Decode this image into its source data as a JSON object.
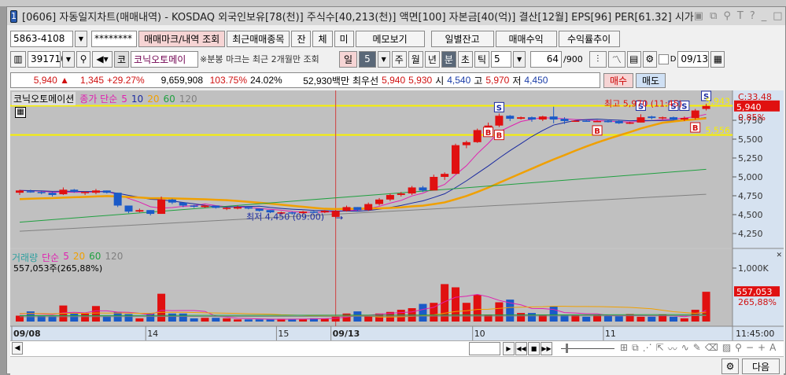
{
  "window": {
    "number": "1",
    "title": "[0606] 자동일지차트(매매내역) - KOSDAQ 외국인보유[78(천)] 주식수[40,213(천)] 액면[100] 자본금[40(억)] 결산[12월] EPS[96] PER[61.32] 시가"
  },
  "toolbar1": {
    "account": "5863-4108",
    "password": "********",
    "trade_mark_query": "매매마크/내역 조회",
    "recent_items": "최근매매종목",
    "jan": "잔",
    "che": "체",
    "mi": "미",
    "memo": "메모보기",
    "daily_balance": "일별잔고",
    "trade_profit": "매매수익",
    "return_trend": "수익률추이"
  },
  "toolbar2": {
    "code": "391710",
    "market": "코",
    "name": "코닉오토메이",
    "notice": "※분봉 마크는 최근 2개월만 조회",
    "day": "일",
    "day_n": "5",
    "week": "주",
    "month": "월",
    "year": "년",
    "minute": "분",
    "second": "초",
    "tick": "틱",
    "interval": "5",
    "count": "64",
    "count_max": "/900",
    "d_label": "D",
    "date": "09/13"
  },
  "quote": {
    "price": "5,940",
    "change": "1,345",
    "change_pct": "+29.27%",
    "volume": "9,659,908",
    "vol_ratio": "103.75%",
    "turnover": "24.02%",
    "amount": "52,930백만",
    "best_label": "최우선",
    "ask": "5,940",
    "bid": "5,930",
    "open_label": "시",
    "open": "4,540",
    "high_label": "고",
    "high": "5,970",
    "low_label": "저",
    "low": "4,450",
    "buy": "매수",
    "sell": "매도"
  },
  "price_pane": {
    "name": "코닉오토메이션",
    "ma_label": "종가 단순",
    "ma": [
      "5",
      "10",
      "20",
      "60",
      "120"
    ],
    "ma_colors": [
      "#e020b0",
      "#1a2aa0",
      "#f0a000",
      "#20a040",
      "#808080"
    ],
    "high_annot": "최고 5,970 (11:45)",
    "low_annot": "최저 4,450 (09:00)",
    "line_hi": "5,943",
    "line_lo": "5,556",
    "line_hi_val": 5943,
    "line_lo_val": 5556,
    "cur_label": "5,940",
    "c_label": "C:33.48",
    "pct_label": "0.85%",
    "axis": [
      "5,750",
      "5,500",
      "5,250",
      "5,000",
      "4,750",
      "4,500",
      "4,250"
    ]
  },
  "volume_pane": {
    "name": "거래량",
    "ma_label": "단순",
    "ma": [
      "5",
      "20",
      "60",
      "120"
    ],
    "current": "557,053주(265,88%)",
    "axis": "1,000K",
    "cur_vol": "557,053",
    "cur_pct": "265,88%"
  },
  "dates": [
    "09/08",
    "14",
    "15",
    "09/13",
    "10",
    "11"
  ],
  "time_label": "11:45:00",
  "bottom": {
    "next": "다음"
  },
  "chart_data": {
    "type": "candlestick",
    "ylim": [
      4150,
      6050
    ],
    "candles": [
      [
        4790,
        4830,
        4760,
        4820
      ],
      [
        4810,
        4830,
        4790,
        4800
      ],
      [
        4800,
        4810,
        4770,
        4790
      ],
      [
        4790,
        4800,
        4740,
        4760
      ],
      [
        4770,
        4860,
        4760,
        4830
      ],
      [
        4830,
        4840,
        4790,
        4800
      ],
      [
        4800,
        4810,
        4760,
        4800
      ],
      [
        4790,
        4840,
        4770,
        4820
      ],
      [
        4820,
        4820,
        4780,
        4790
      ],
      [
        4790,
        4790,
        4600,
        4620
      ],
      [
        4620,
        4620,
        4520,
        4540
      ],
      [
        4540,
        4580,
        4530,
        4560
      ],
      [
        4560,
        4560,
        4490,
        4510
      ],
      [
        4510,
        4740,
        4510,
        4700
      ],
      [
        4700,
        4710,
        4640,
        4660
      ],
      [
        4660,
        4660,
        4600,
        4620
      ],
      [
        4620,
        4630,
        4590,
        4610
      ],
      [
        4600,
        4630,
        4590,
        4620
      ],
      [
        4620,
        4620,
        4580,
        4590
      ],
      [
        4580,
        4600,
        4560,
        4590
      ],
      [
        4580,
        4620,
        4570,
        4600
      ],
      [
        4600,
        4600,
        4570,
        4580
      ],
      [
        4580,
        4580,
        4540,
        4550
      ],
      [
        4560,
        4560,
        4520,
        4530
      ],
      [
        4520,
        4540,
        4500,
        4530
      ],
      [
        4530,
        4540,
        4500,
        4520
      ],
      [
        4520,
        4550,
        4500,
        4540
      ],
      [
        4540,
        4550,
        4520,
        4530
      ],
      [
        4530,
        4560,
        4520,
        4550
      ],
      [
        4470,
        4560,
        4450,
        4550
      ],
      [
        4550,
        4620,
        4540,
        4600
      ],
      [
        4600,
        4600,
        4540,
        4560
      ],
      [
        4560,
        4660,
        4550,
        4640
      ],
      [
        4640,
        4720,
        4620,
        4700
      ],
      [
        4700,
        4780,
        4680,
        4760
      ],
      [
        4760,
        4800,
        4740,
        4780
      ],
      [
        4780,
        4880,
        4760,
        4860
      ],
      [
        4860,
        4880,
        4800,
        4820
      ],
      [
        4820,
        5030,
        4820,
        5000
      ],
      [
        5000,
        5060,
        4960,
        5040
      ],
      [
        5040,
        5440,
        5040,
        5420
      ],
      [
        5420,
        5480,
        5380,
        5460
      ],
      [
        5460,
        5640,
        5450,
        5620
      ],
      [
        5620,
        5720,
        5600,
        5680
      ],
      [
        5680,
        5840,
        5660,
        5810
      ],
      [
        5810,
        5820,
        5740,
        5770
      ],
      [
        5770,
        5800,
        5760,
        5790
      ],
      [
        5790,
        5800,
        5730,
        5760
      ],
      [
        5760,
        5810,
        5740,
        5800
      ],
      [
        5800,
        5930,
        5710,
        5760
      ],
      [
        5770,
        5790,
        5700,
        5740
      ],
      [
        5740,
        5750,
        5730,
        5745
      ],
      [
        5745,
        5760,
        5730,
        5740
      ],
      [
        5740,
        5750,
        5730,
        5740
      ],
      [
        5745,
        5760,
        5720,
        5725
      ],
      [
        5740,
        5750,
        5700,
        5710
      ],
      [
        5710,
        5730,
        5700,
        5720
      ],
      [
        5720,
        5830,
        5720,
        5790
      ],
      [
        5800,
        5810,
        5760,
        5780
      ],
      [
        5780,
        5800,
        5760,
        5790
      ],
      [
        5790,
        5800,
        5750,
        5760
      ],
      [
        5760,
        5800,
        5740,
        5780
      ],
      [
        5780,
        5900,
        5760,
        5880
      ],
      [
        5900,
        5970,
        5880,
        5940
      ]
    ],
    "volume": [
      110,
      190,
      110,
      100,
      300,
      160,
      150,
      290,
      100,
      180,
      140,
      60,
      150,
      520,
      150,
      150,
      60,
      70,
      70,
      60,
      40,
      40,
      40,
      40,
      50,
      50,
      50,
      60,
      60,
      90,
      150,
      190,
      100,
      150,
      180,
      220,
      250,
      330,
      350,
      700,
      640,
      350,
      500,
      130,
      360,
      410,
      160,
      160,
      120,
      280,
      120,
      120,
      90,
      120,
      110,
      100,
      140,
      90,
      90,
      130,
      90,
      60,
      220,
      557
    ],
    "ma60": [
      4400,
      5100
    ],
    "ma120": [
      4280,
      4770
    ],
    "ma20_start": 4700
  }
}
